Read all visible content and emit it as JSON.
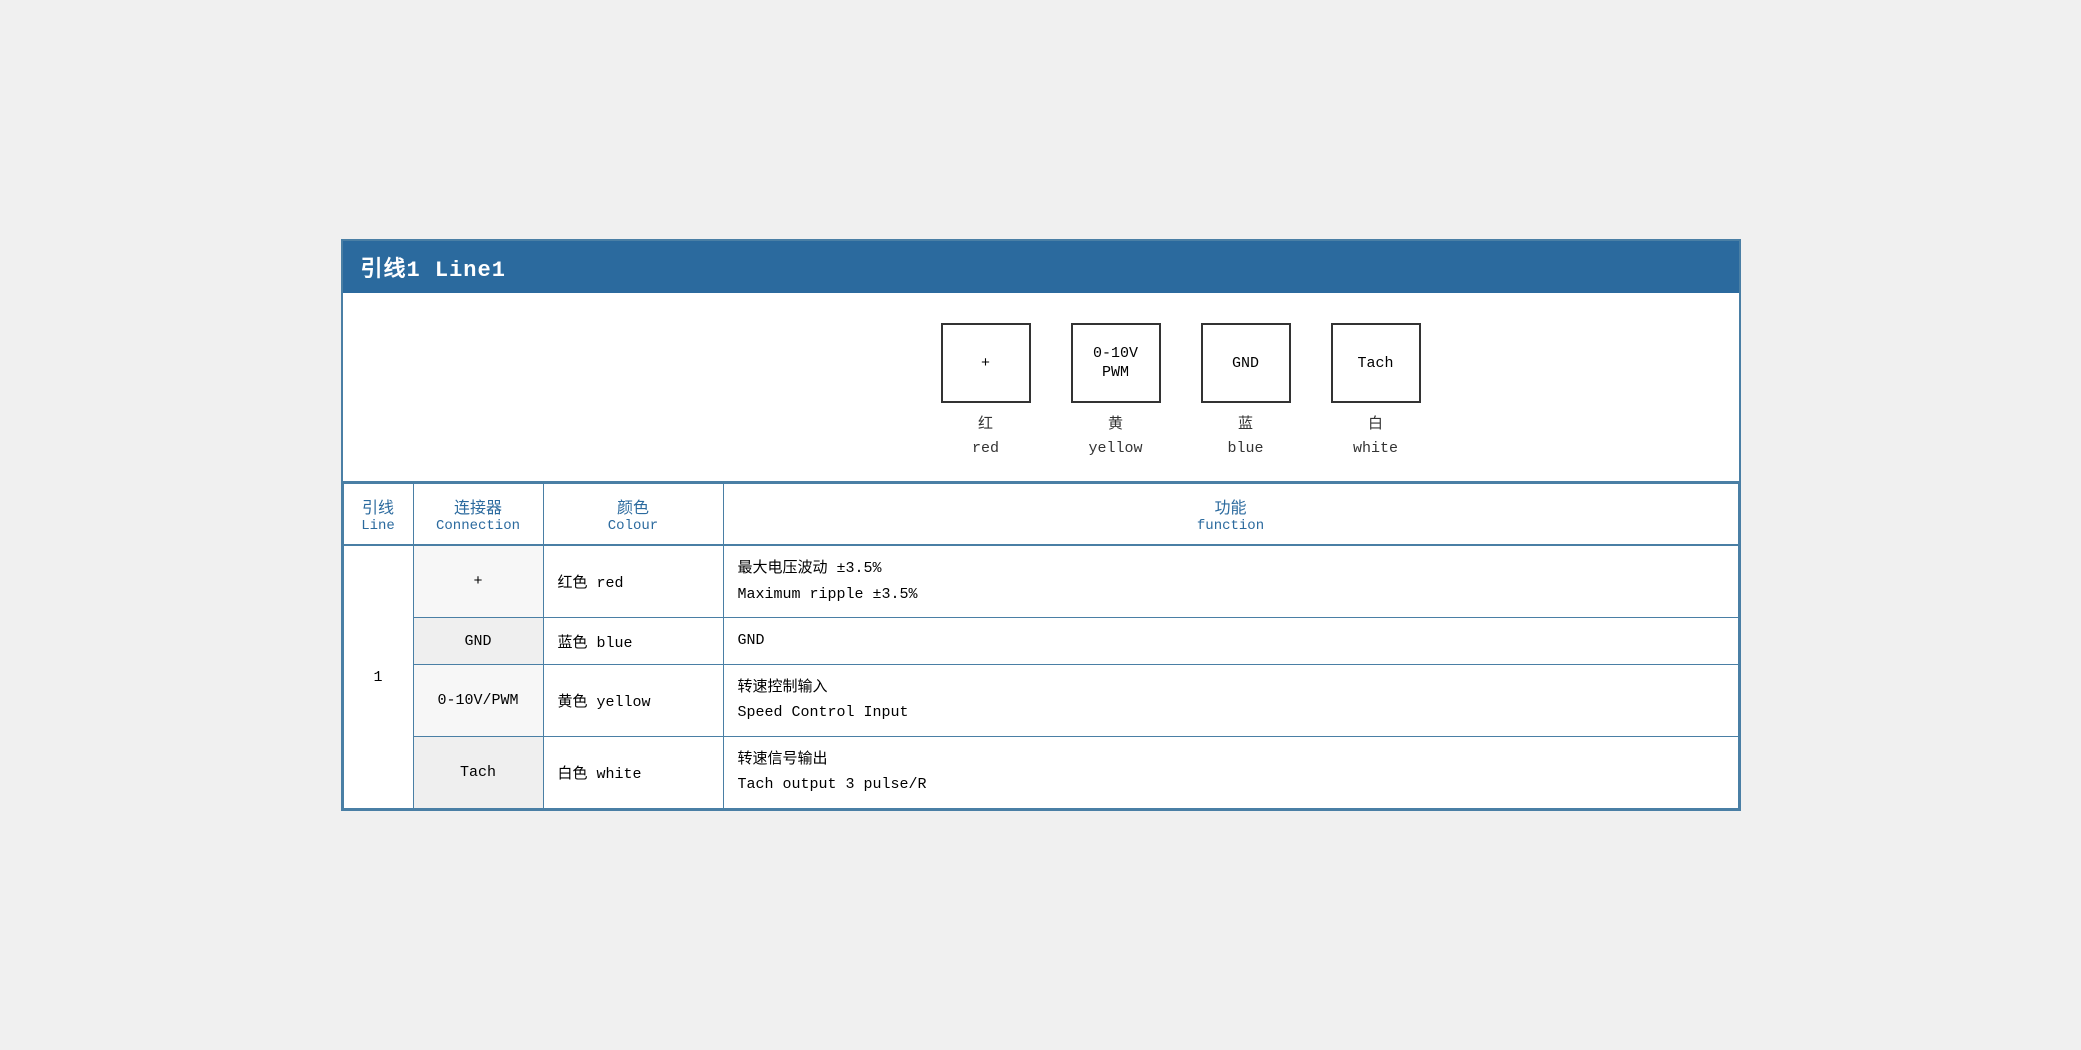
{
  "title": "引线1 Line1",
  "diagram": {
    "connectors": [
      {
        "id": "plus",
        "label": "+",
        "multiline": false
      },
      {
        "id": "pwm",
        "label": "0-10V\nPWM",
        "multiline": true
      },
      {
        "id": "gnd",
        "label": "GND",
        "multiline": false
      },
      {
        "id": "tach",
        "label": "Tach",
        "multiline": false
      }
    ],
    "labels": [
      {
        "zh": "红",
        "en": "red"
      },
      {
        "zh": "黄",
        "en": "yellow"
      },
      {
        "zh": "蓝",
        "en": "blue"
      },
      {
        "zh": "白",
        "en": "white"
      }
    ]
  },
  "table": {
    "headers": [
      {
        "zh": "引线",
        "en": "Line"
      },
      {
        "zh": "连接器",
        "en": "Connection"
      },
      {
        "zh": "颜色",
        "en": "Colour"
      },
      {
        "zh": "功能",
        "en": "function"
      }
    ],
    "rows": [
      {
        "line": "1",
        "connection": "+",
        "colour_zh": "红色",
        "colour_en": "red",
        "function_zh": "最大电压波动 ±3.5%",
        "function_en": "Maximum ripple ±3.5%"
      },
      {
        "line": "",
        "connection": "GND",
        "colour_zh": "蓝色",
        "colour_en": "blue",
        "function_zh": "GND",
        "function_en": ""
      },
      {
        "line": "",
        "connection": "0-10V/PWM",
        "colour_zh": "黄色",
        "colour_en": "yellow",
        "function_zh": "转速控制输入",
        "function_en": "Speed Control Input"
      },
      {
        "line": "",
        "connection": "Tach",
        "colour_zh": "白色",
        "colour_en": "white",
        "function_zh": "转速信号输出",
        "function_en": "Tach output 3 pulse/R"
      }
    ]
  }
}
